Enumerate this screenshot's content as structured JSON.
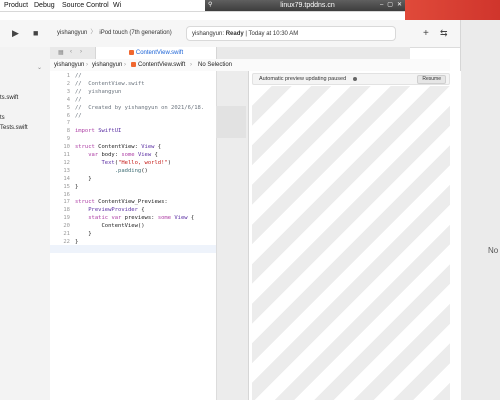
{
  "menubar": {
    "items": [
      "Product",
      "Debug",
      "Source Control",
      "Wi"
    ],
    "remote_title": "linux79.tpddns.cn"
  },
  "toolbar": {
    "scheme": "yishangyun",
    "device": "iPod touch (7th generation)",
    "status_app": "yishangyun:",
    "status_state": "Ready",
    "status_time": "Today at 10:30 AM"
  },
  "navigator": {
    "items": [
      "ts.swift",
      "ts",
      "Tests.swift"
    ]
  },
  "tabbar": {
    "active_tab": "ContentView.swift"
  },
  "jumpbar": {
    "parts": [
      "yishangyun",
      "yishangyun",
      "ContentView.swift",
      "No Selection"
    ]
  },
  "editor": {
    "line_numbers": [
      "1",
      "2",
      "3",
      "4",
      "5",
      "6",
      "7",
      "8",
      "9",
      "10",
      "11",
      "12",
      "13",
      "14",
      "15",
      "16",
      "17",
      "18",
      "19",
      "20",
      "21",
      "22"
    ],
    "lines": [
      "//",
      "//  ContentView.swift",
      "//  yishangyun",
      "//",
      "//  Created by yishangyun on 2021/6/18.",
      "//",
      "",
      "import SwiftUI",
      "",
      "struct ContentView: View {",
      "    var body: some View {",
      "        Text(\"Hello, world!\")",
      "            .padding()",
      "    }",
      "}",
      "",
      "struct ContentView_Previews:",
      "    PreviewProvider {",
      "    static var previews: some View {",
      "        ContentView()",
      "    }",
      "}"
    ]
  },
  "canvas": {
    "status_message": "Automatic preview updating paused",
    "resume_label": "Resume",
    "right_edge_text": "No"
  },
  "colors": {
    "accent": "#1a62d6",
    "keyword": "#ad3da4",
    "string": "#c41a16",
    "comment": "#6a737d",
    "red_stripe": "#e04a3a"
  }
}
